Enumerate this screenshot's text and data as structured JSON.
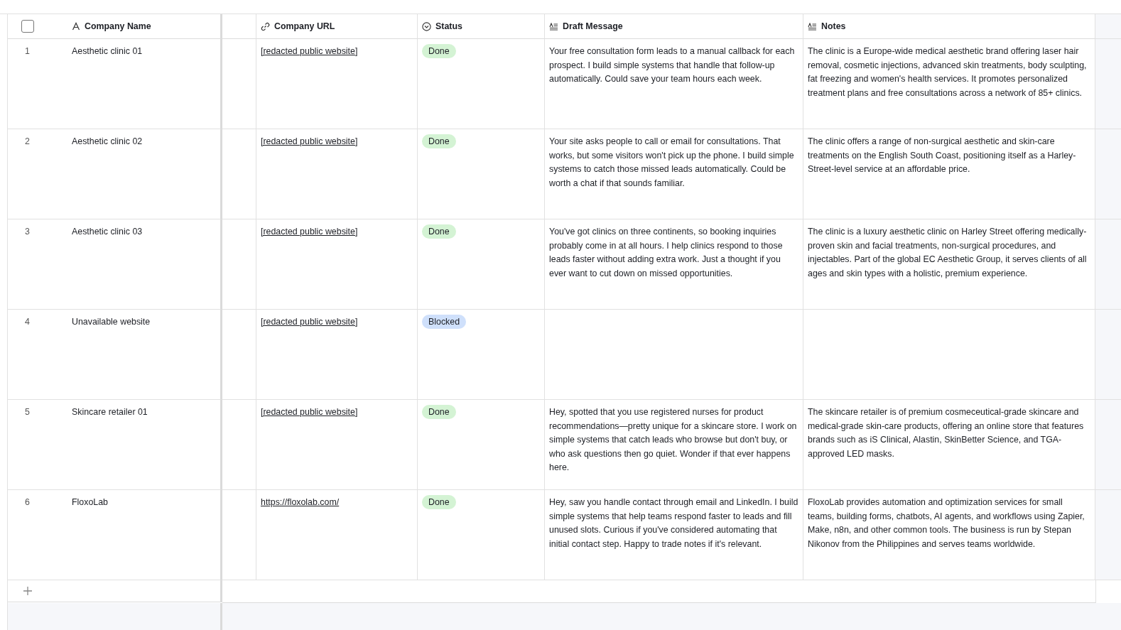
{
  "table": {
    "select_all": {
      "checked": false
    },
    "columns": [
      {
        "label": "Company Name",
        "kind": "text"
      },
      {
        "label": "Company URL",
        "kind": "link"
      },
      {
        "label": "Status",
        "kind": "status"
      },
      {
        "label": "Draft Message",
        "kind": "longtext"
      },
      {
        "label": "Notes",
        "kind": "longtext"
      }
    ],
    "rows": [
      {
        "number": "1",
        "name": "Aesthetic clinic 01",
        "url": "[redacted public website]",
        "status": {
          "label": "Done",
          "color": "#d4f3d4"
        },
        "draft": "Your free consultation form leads to a manual callback for each prospect. I build simple systems that handle that follow-up automatically. Could save your team hours each week.",
        "notes": "The clinic is a Europe-wide medical aesthetic brand offering laser hair removal, cosmetic injections, advanced skin treatments, body sculpting, fat freezing and women's health services. It promotes personalized treatment plans and free consultations across a network of 85+ clinics."
      },
      {
        "number": "2",
        "name": "Aesthetic clinic 02",
        "url": "[redacted public website]",
        "status": {
          "label": "Done",
          "color": "#d4f3d4"
        },
        "draft": "Your site asks people to call or email for consultations. That works, but some visitors won't pick up the phone. I build simple systems to catch those missed leads automatically. Could be worth a chat if that sounds familiar.",
        "notes": "The clinic offers a range of non-surgical aesthetic and skin-care treatments on the English South Coast, positioning itself as a Harley-Street-level service at an affordable price."
      },
      {
        "number": "3",
        "name": "Aesthetic clinic 03",
        "url": "[redacted public website]",
        "status": {
          "label": "Done",
          "color": "#d4f3d4"
        },
        "draft": "You've got clinics on three continents, so booking inquiries probably come in at all hours. I help clinics respond to those leads faster without adding extra work. Just a thought if you ever want to cut down on missed opportunities.",
        "notes": "The clinic is a luxury aesthetic clinic on Harley Street offering medically-proven skin and facial treatments, non-surgical procedures, and injectables. Part of the global EC Aesthetic Group, it serves clients of all ages and skin types with a holistic, premium experience."
      },
      {
        "number": "4",
        "name": "Unavailable website",
        "url": "[redacted public website]",
        "status": {
          "label": "Blocked",
          "color": "#cfe0fb"
        }
      },
      {
        "number": "5",
        "name": "Skincare retailer 01",
        "url": "[redacted public website]",
        "status": {
          "label": "Done",
          "color": "#d4f3d4"
        },
        "draft": "Hey, spotted that you use registered nurses for product recommendations—pretty unique for a skincare store. I work on simple systems that catch leads who browse but don't buy, or who ask questions then go quiet. Wonder if that ever happens here.",
        "notes": "The skincare retailer is of premium cosmeceutical-grade skincare and medical-grade skin-care products, offering an online store that features brands such as iS Clinical, Alastin, SkinBetter Science, and TGA-approved LED masks."
      },
      {
        "number": "6",
        "name": "FloxoLab",
        "url": "https://floxolab.com/",
        "status": {
          "label": "Done",
          "color": "#d4f3d4"
        },
        "draft": "Hey, saw you handle contact through email and LinkedIn. I build simple systems that help teams respond faster to leads and fill unused slots. Curious if you've considered automating that initial contact step. Happy to trade notes if it's relevant.",
        "notes": "FloxoLab provides automation and optimization services for small teams, building forms, chatbots, AI agents, and workflows using Zapier, Make, n8n, and other common tools. The business is run by Stepan Nikonov from the Philippines and serves teams worldwide."
      }
    ]
  }
}
